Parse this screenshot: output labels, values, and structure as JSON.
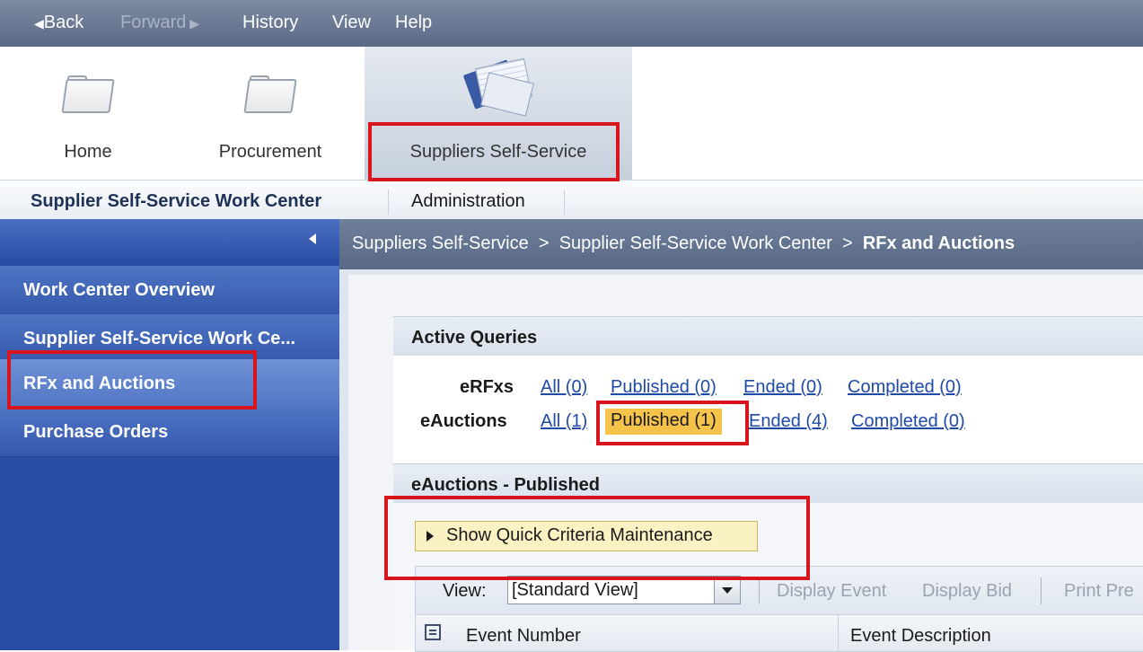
{
  "menubar": {
    "back": "Back",
    "forward": "Forward",
    "history": "History",
    "view": "View",
    "help": "Help"
  },
  "nav_tabs": [
    {
      "label": "Home",
      "icon": "folder-icon"
    },
    {
      "label": "Procurement",
      "icon": "folder-icon"
    },
    {
      "label": "Suppliers Self-Service",
      "icon": "documents-icon",
      "active": true
    }
  ],
  "subtabs": [
    {
      "label": "Supplier Self-Service Work Center",
      "active": true
    },
    {
      "label": "Administration"
    }
  ],
  "sidebar": {
    "items": [
      {
        "label": "Work Center Overview"
      },
      {
        "label": "Supplier Self-Service Work Ce..."
      },
      {
        "label": "RFx and Auctions",
        "selected": true
      },
      {
        "label": "Purchase Orders"
      }
    ]
  },
  "breadcrumb": {
    "part1": "Suppliers Self-Service",
    "sep": ">",
    "part2": "Supplier Self-Service Work Center",
    "current": "RFx and Auctions"
  },
  "active_queries": {
    "title": "Active Queries",
    "erfxs": {
      "label": "eRFxs",
      "links": [
        "All (0)",
        "Published (0)",
        "Ended (0)",
        "Completed (0)"
      ]
    },
    "eauctions": {
      "label": "eAuctions",
      "links": [
        "All (1)",
        "Published (1)",
        "Ended (4)",
        "Completed (0)"
      ],
      "highlighted": "Published (1)"
    }
  },
  "eauctions_published": {
    "title": "eAuctions - Published",
    "quick_criteria_button": "Show Quick Criteria Maintenance",
    "toolbar": {
      "view_label": "View:",
      "view_value": "[Standard View]",
      "display_event": "Display Event",
      "display_bid": "Display Bid",
      "print_preview": "Print Pre"
    },
    "columns": [
      "Event Number",
      "Event Description"
    ]
  },
  "colors": {
    "menubar": "#5b6986",
    "sidebar": "#2a4ea6",
    "highlight": "#f6c34a",
    "annotation_red": "#d8141c",
    "link": "#1f4aa8"
  }
}
